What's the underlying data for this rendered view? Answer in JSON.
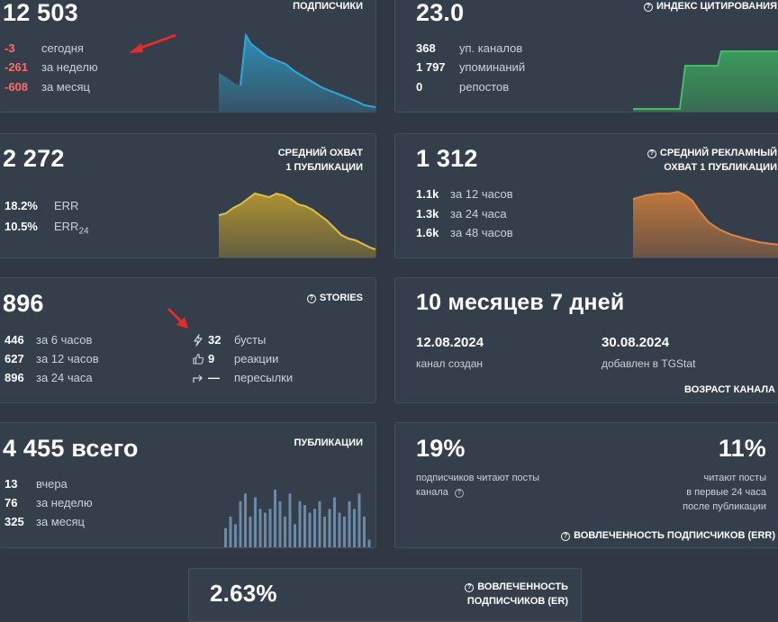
{
  "subscribers": {
    "title": "ПОДПИСЧИКИ",
    "value": "12 503",
    "rows": [
      {
        "value": "-3",
        "label": "сегодня"
      },
      {
        "value": "-261",
        "label": "за неделю"
      },
      {
        "value": "-608",
        "label": "за месяц"
      }
    ]
  },
  "citation": {
    "title": "ИНДЕКС ЦИТИРОВАНИЯ",
    "value": "23.0",
    "rows": [
      {
        "value": "368",
        "label": "уп. каналов"
      },
      {
        "value": "1 797",
        "label": "упоминаний"
      },
      {
        "value": "0",
        "label": "репостов"
      }
    ]
  },
  "reach": {
    "title_line1": "СРЕДНИЙ ОХВАТ",
    "title_line2": "1 ПУБЛИКАЦИИ",
    "value": "2 272",
    "rows": [
      {
        "value": "18.2%",
        "label": "ERR"
      },
      {
        "value": "10.5%",
        "label": "ERR",
        "sub": "24"
      }
    ]
  },
  "ad_reach": {
    "title_line1": "СРЕДНИЙ РЕКЛАМНЫЙ",
    "title_line2": "ОХВАТ 1 ПУБЛИКАЦИИ",
    "value": "1 312",
    "rows": [
      {
        "value": "1.1k",
        "label": "за 12 часов"
      },
      {
        "value": "1.3k",
        "label": "за 24 часа"
      },
      {
        "value": "1.6k",
        "label": "за 48 часов"
      }
    ]
  },
  "stories": {
    "title": "STORIES",
    "value": "896",
    "rows": [
      {
        "value": "446",
        "label": "за 6 часов"
      },
      {
        "value": "627",
        "label": "за 12 часов"
      },
      {
        "value": "896",
        "label": "за 24 часа"
      }
    ],
    "extra": [
      {
        "icon": "lightning-icon",
        "value": "32",
        "label": "бусты"
      },
      {
        "icon": "thumbs-up-icon",
        "value": "9",
        "label": "реакции"
      },
      {
        "icon": "forward-arrow-icon",
        "value": "—",
        "label": "пересылки"
      }
    ]
  },
  "age": {
    "value": "10 месяцев 7 дней",
    "created_date": "12.08.2024",
    "created_label": "канал создан",
    "added_date": "30.08.2024",
    "added_label": "добавлен в TGStat",
    "title": "ВОЗРАСТ КАНАЛА"
  },
  "posts": {
    "title": "ПУБЛИКАЦИИ",
    "value": "4 455 всего",
    "rows": [
      {
        "value": "13",
        "label": "вчера"
      },
      {
        "value": "76",
        "label": "за неделю"
      },
      {
        "value": "325",
        "label": "за месяц"
      }
    ],
    "bars": [
      5,
      8,
      6,
      12,
      14,
      8,
      13,
      10,
      9,
      10,
      15,
      12,
      8,
      14,
      6,
      12,
      11,
      9,
      10,
      12,
      8,
      10,
      13,
      9,
      8,
      12,
      10,
      14,
      8,
      2
    ]
  },
  "engagement": {
    "left_value": "19%",
    "left_line1": "подписчиков читают посты",
    "left_line2": "канала",
    "right_value": "11%",
    "right_line1": "читают посты",
    "right_line2": "в первые 24 часа",
    "right_line3": "после публикации",
    "title": "ВОВЛЕЧЕННОСТЬ ПОДПИСЧИКОВ (ERR)"
  },
  "er": {
    "value": "2.63%",
    "title_line1": "ВОВЛЕЧЕННОСТЬ",
    "title_line2": "ПОДПИСЧИКОВ (ER)"
  },
  "colors": {
    "subscribers_line": "#2fa8d8",
    "citation_line": "#3fbf62",
    "reach_line": "#c9a52b",
    "ad_reach_line": "#e0843a",
    "bars": "#6b8aa6",
    "negative": "#ff6b6b",
    "arrow": "#e62b2b"
  }
}
